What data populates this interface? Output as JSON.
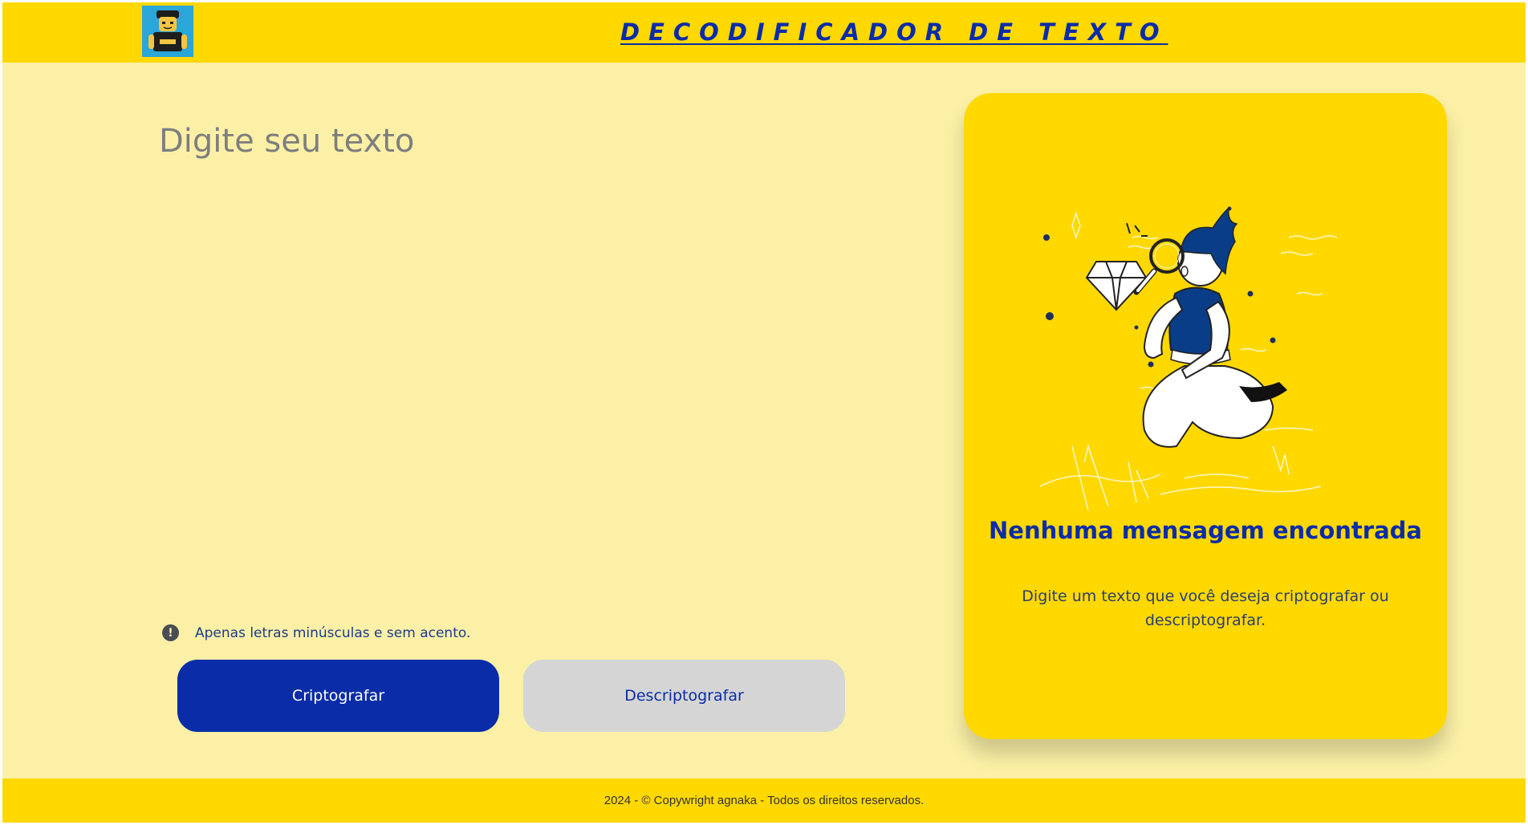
{
  "header": {
    "title": "DECODIFICADOR DE TEXTO",
    "logo_icon": "lego-figure-avatar"
  },
  "input": {
    "placeholder": "Digite seu texto",
    "value": ""
  },
  "hint": {
    "icon": "exclamation-circle-icon",
    "text": "Apenas letras minúsculas e sem acento."
  },
  "buttons": {
    "encrypt_label": "Criptografar",
    "decrypt_label": "Descriptografar"
  },
  "output_card": {
    "illustration": "person-with-magnifying-glass-and-diamond",
    "title": "Nenhuma mensagem encontrada",
    "text": "Digite um texto que você deseja criptografar ou descriptografar."
  },
  "footer": {
    "text": "2024 - © Copywright agnaka - Todos os direitos reservados."
  },
  "colors": {
    "primary": "#0a2ca8",
    "accent_yellow": "#ffd800",
    "background": "#fbf0a6",
    "secondary_button": "#d5d5d5"
  }
}
